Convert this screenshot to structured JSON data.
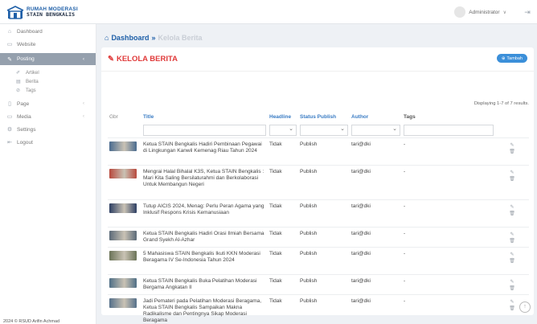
{
  "brand": {
    "line1": "RUMAH MODERASI",
    "line2": "STAIN BENGKALIS"
  },
  "user": {
    "name": "Administrator"
  },
  "sidebar": {
    "items": [
      {
        "label": "Dashboard",
        "icon": "home-icon"
      },
      {
        "label": "Website",
        "icon": "monitor-icon"
      },
      {
        "label": "Posting",
        "icon": "edit-icon",
        "active": true
      },
      {
        "label": "Artikel",
        "icon": "pen-icon",
        "sub": true
      },
      {
        "label": "Berita",
        "icon": "newspaper-icon",
        "sub": true
      },
      {
        "label": "Tags",
        "icon": "tag-icon",
        "sub": true
      },
      {
        "label": "Page",
        "icon": "page-icon"
      },
      {
        "label": "Media",
        "icon": "folder-icon"
      },
      {
        "label": "Settings",
        "icon": "gear-icon"
      },
      {
        "label": "Logout",
        "icon": "logout-icon"
      }
    ],
    "footer": "2024 © RSUD Arifin Achmad"
  },
  "breadcrumb": {
    "root": "Dashboard",
    "sep": "»",
    "current": "Kelola Berita"
  },
  "card": {
    "title": "KELOLA BERITA",
    "add_label": "Tambah",
    "summary": "Displaying 1-7 of 7 results."
  },
  "table": {
    "headers": {
      "img": "Gbr",
      "title": "Title",
      "headline": "Headline",
      "status": "Status Publish",
      "author": "Author",
      "tags": "Tags"
    },
    "rows": [
      {
        "title": "Ketua STAIN Bengkalis Hadiri Pembinaan Pegawai di Lingkungan Kanwil Kemenag Riau Tahun 2024",
        "headline": "Tidak",
        "status": "Publish",
        "author": "tari@dki",
        "tags": "-",
        "thumb_color": "#4a6b8f"
      },
      {
        "title": "Mengrai Halal Bihalal K3S, Ketua STAIN Bengkalis : Mari Kita Saling Bersilaturahmi dan Berkolaborasi Untuk Membangun Negeri",
        "headline": "Tidak",
        "status": "Publish",
        "author": "tari@dki",
        "tags": "-",
        "thumb_color": "#b8493d"
      },
      {
        "title": "Tutup AICIS 2024, Menag: Perlu Peran Agama yang Inklusif Respons Krisis Kemanusiaan",
        "headline": "Tidak",
        "status": "Publish",
        "author": "tari@dki",
        "tags": "-",
        "thumb_color": "#2d3f63"
      },
      {
        "title": "Ketua STAIN Bengkalis Hadiri Orasi Ilmiah Bersama Grand Syekh Al-Azhar",
        "headline": "Tidak",
        "status": "Publish",
        "author": "tari@dki",
        "tags": "-",
        "thumb_color": "#5b6a78"
      },
      {
        "title": "5 Mahasiswa STAIN Bengkalis Ikuti KKN Moderasi Beragama IV Se-Indonesia Tahun 2024",
        "headline": "Tidak",
        "status": "Publish",
        "author": "tari@dki",
        "tags": "-",
        "thumb_color": "#6b7458"
      },
      {
        "title": "Ketua STAIN Bengkalis Buka Pelatihan Moderasi Bergama Angkatan II",
        "headline": "Tidak",
        "status": "Publish",
        "author": "tari@dki",
        "tags": "-",
        "thumb_color": "#4f6f86"
      },
      {
        "title": "Jadi Pemateri pada Pelatihan Moderasi Beragama, Ketua STAIN Bengkalis Sampaikan Makna Radikalisme dan Pentingnya Sikap Moderasi Beragama",
        "headline": "Tidak",
        "status": "Publish",
        "author": "tari@dki",
        "tags": "-",
        "thumb_color": "#55708a"
      }
    ]
  },
  "colors": {
    "accent": "#1e5fa8",
    "title_red": "#e03a3a",
    "button_blue": "#3b8fd9",
    "sidebar_active": "#95a0ad"
  }
}
